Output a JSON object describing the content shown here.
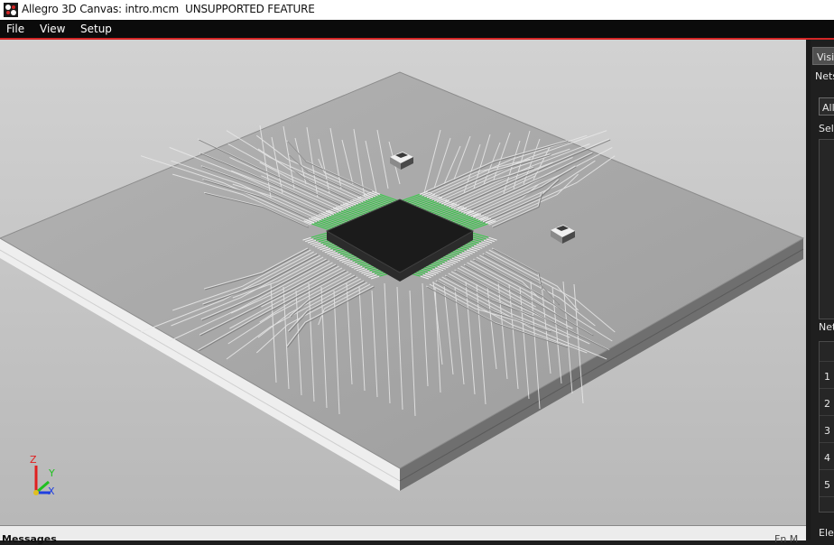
{
  "window": {
    "title": "Allegro 3D Canvas: intro.mcm  UNSUPPORTED FEATURE",
    "icon": "app-icon"
  },
  "menu": {
    "items": [
      "File",
      "View",
      "Setup"
    ]
  },
  "axes": {
    "z": "Z",
    "y": "Y",
    "x": "X",
    "colors": {
      "z": "#e02020",
      "y": "#20c020",
      "x": "#2040e0"
    }
  },
  "messages": {
    "label": "Messages",
    "right_text": "Fn M"
  },
  "side_panel": {
    "tab_label": "Visib",
    "nets_label": "Nets",
    "filter_value": "All",
    "selected_label": "Sel",
    "nets_table_label": "Net",
    "rows": [
      "1",
      "2",
      "3",
      "4",
      "5"
    ],
    "elements_label": "Ele"
  },
  "colors": {
    "menubar_accent": "#d32626",
    "trace_highlight": "#2ecc40",
    "board_top": "#a6a6a6"
  }
}
